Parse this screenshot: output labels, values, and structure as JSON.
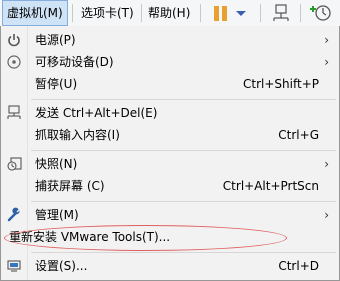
{
  "menubar": {
    "items": [
      {
        "label": "虚拟机(M)"
      },
      {
        "label": "选项卡(T)"
      },
      {
        "label": "帮助(H)"
      }
    ]
  },
  "menu": {
    "items": [
      {
        "label": "电源(P)",
        "shortcut": "",
        "submenu": true,
        "icon": "power-icon"
      },
      {
        "label": "可移动设备(D)",
        "shortcut": "",
        "submenu": true,
        "icon": "disc-icon"
      },
      {
        "label": "暂停(U)",
        "shortcut": "Ctrl+Shift+P",
        "submenu": false,
        "icon": ""
      },
      {
        "label": "发送 Ctrl+Alt+Del(E)",
        "shortcut": "",
        "submenu": false,
        "icon": "keyboard-icon"
      },
      {
        "label": "抓取输入内容(I)",
        "shortcut": "Ctrl+G",
        "submenu": false,
        "icon": ""
      },
      {
        "label": "快照(N)",
        "shortcut": "",
        "submenu": true,
        "icon": "snapshot-icon"
      },
      {
        "label": "捕获屏幕 (C)",
        "shortcut": "Ctrl+Alt+PrtScn",
        "submenu": false,
        "icon": ""
      },
      {
        "label": "管理(M)",
        "shortcut": "",
        "submenu": true,
        "icon": "wrench-icon"
      },
      {
        "label": "重新安装 VMware Tools(T)...",
        "shortcut": "",
        "submenu": false,
        "icon": ""
      },
      {
        "label": "设置(S)...",
        "shortcut": "Ctrl+D",
        "submenu": false,
        "icon": "settings-icon"
      }
    ]
  },
  "colors": {
    "accent_orange": "#e8a030",
    "highlight_ellipse": "#e06060"
  }
}
